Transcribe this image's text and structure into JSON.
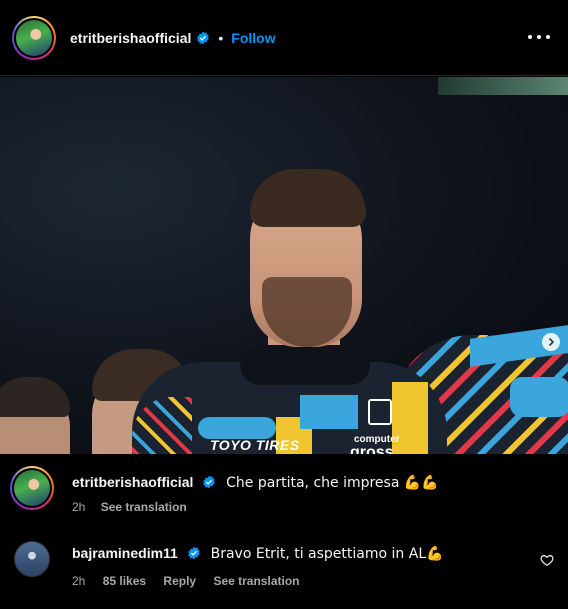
{
  "header": {
    "username": "etritberishaofficial",
    "separator": "•",
    "follow_label": "Follow",
    "more_icon": "more-horizontal-icon"
  },
  "photo": {
    "sponsor_left": "TOYO TIRES",
    "sponsor_right_top": "computer",
    "sponsor_right_bottom": "gross",
    "carousel_count": 2,
    "carousel_active": 1
  },
  "caption": {
    "username": "etritberishaofficial",
    "text": "Che partita, che impresa 💪💪",
    "time": "2h",
    "see_translation": "See translation"
  },
  "comment": {
    "username": "bajraminedim11",
    "text": "Bravo Etrit, ti aspettiamo in AL💪",
    "time": "2h",
    "likes": "85 likes",
    "reply": "Reply",
    "see_translation": "See translation"
  },
  "colors": {
    "background": "#000000",
    "follow_blue": "#0095f6",
    "verified_blue": "#0095f6",
    "meta_gray": "#a8a8a8"
  }
}
